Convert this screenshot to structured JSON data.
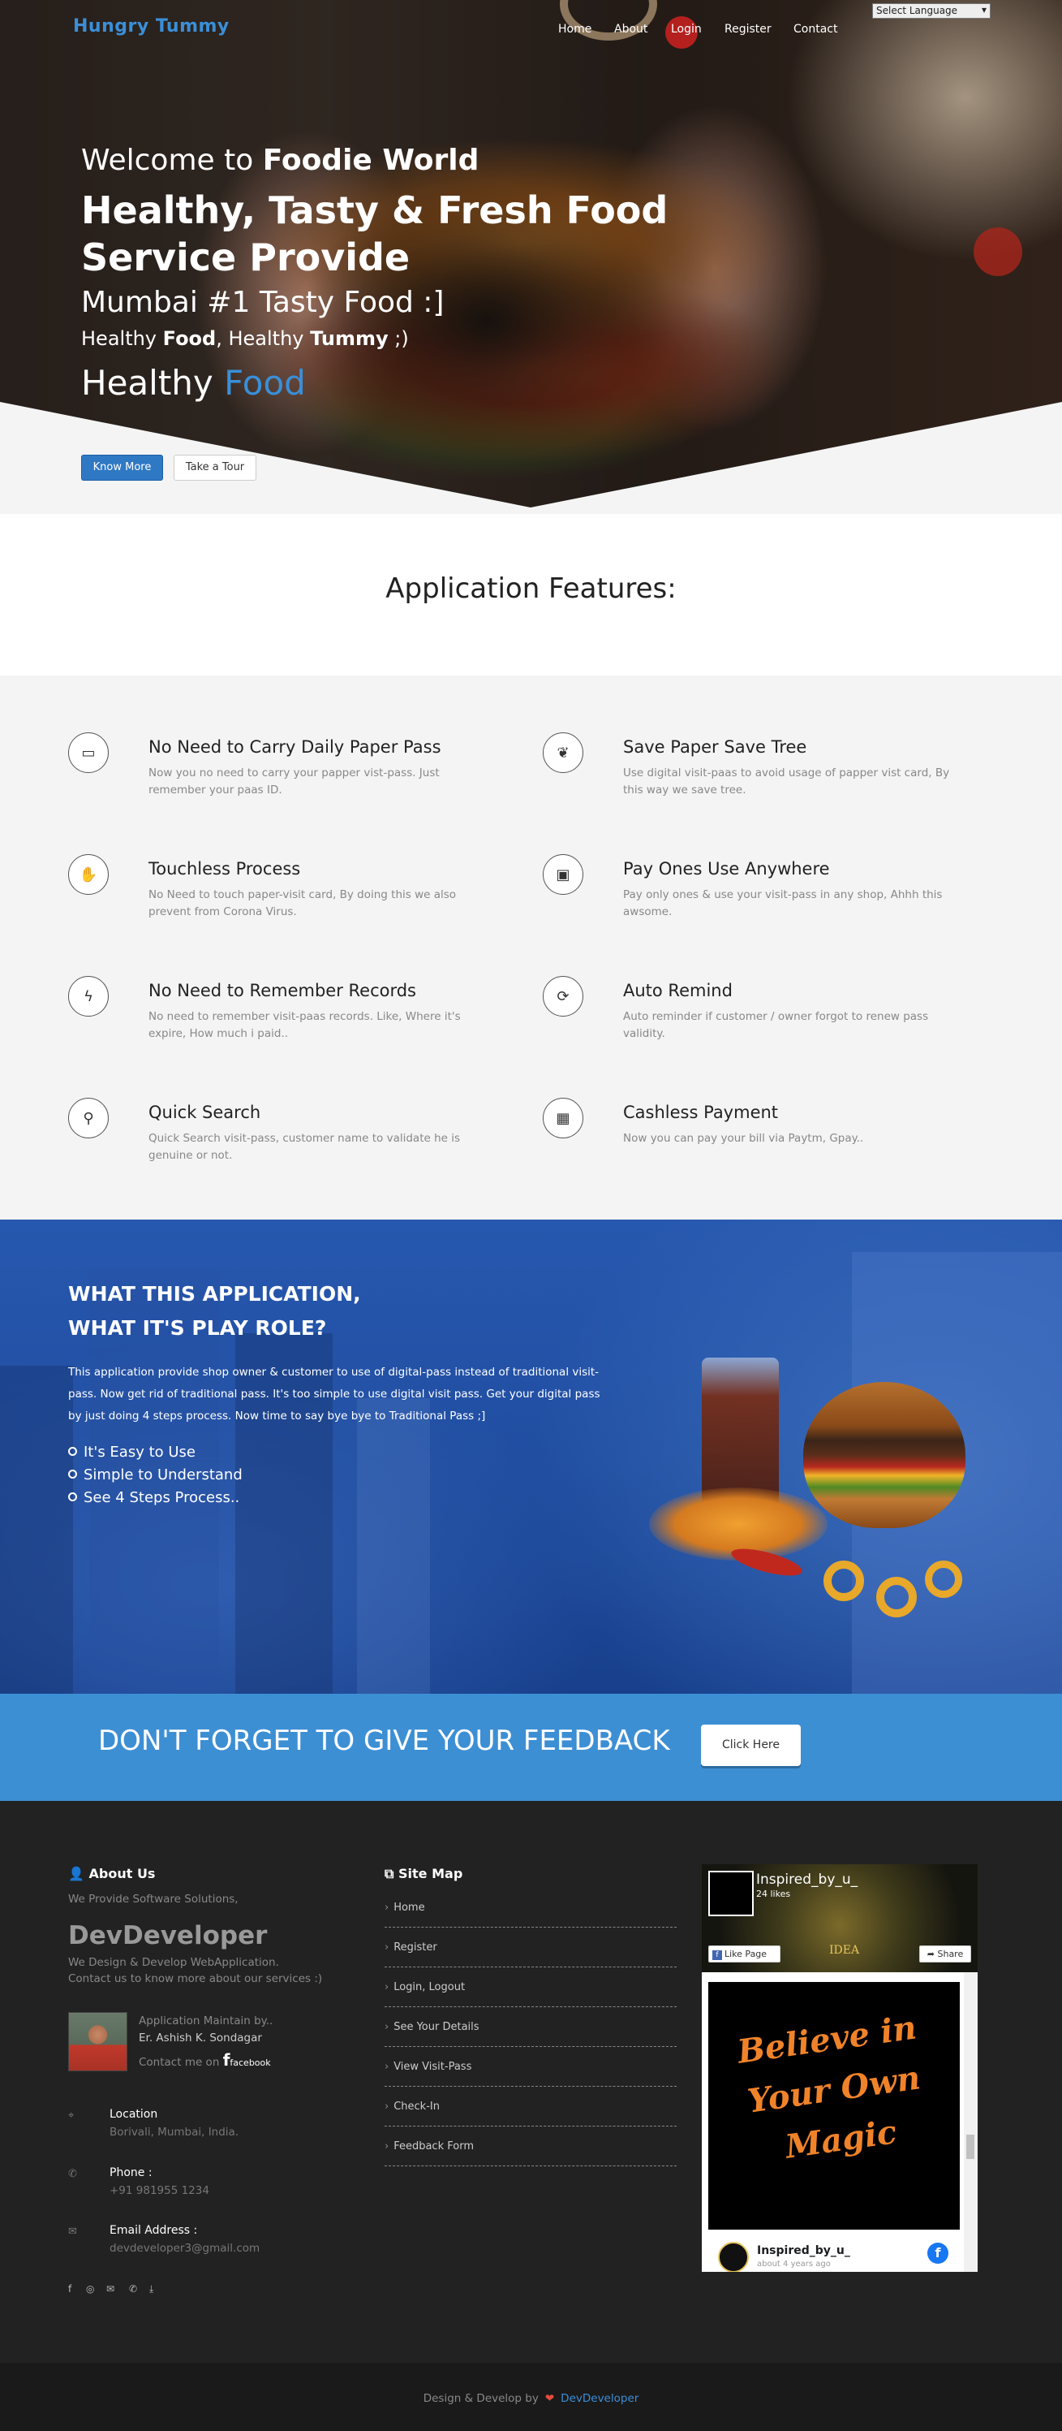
{
  "header": {
    "brand": "Hungry Tummy",
    "nav": [
      "Home",
      "About",
      "Login",
      "Register",
      "Contact"
    ],
    "language_select": "Select Language"
  },
  "hero": {
    "welcome_prefix": "Welcome to ",
    "welcome_name": "Foodie World",
    "headline_1": "Healthy, Tasty & Fresh Food",
    "headline_2": "Service Provide",
    "subline": "Mumbai #1 Tasty Food :]",
    "tag_1": "Healthy ",
    "tag_2": "Food",
    "tag_3": ", Healthy ",
    "tag_4": "Tummy",
    "tag_5": " ;)",
    "typed_1": "Healthy ",
    "typed_2": "Food",
    "know_more": "Know More",
    "take_tour": "Take a Tour"
  },
  "features": {
    "title": "Application Features:",
    "items": [
      {
        "icon": "id-card-icon",
        "title": "No Need to Carry Daily Paper Pass",
        "desc": "Now you no need to carry your papper vist-pass. Just remember your paas ID."
      },
      {
        "icon": "leaf-icon",
        "title": "Save Paper Save Tree",
        "desc": "Use digital visit-paas to avoid usage of papper vist card, By this way we save tree."
      },
      {
        "icon": "hand-icon",
        "title": "Touchless Process",
        "desc": "No Need to touch paper-visit card, By doing this we also prevent from Corona Virus."
      },
      {
        "icon": "money-icon",
        "title": "Pay Ones Use Anywhere",
        "desc": "Pay only ones & use your visit-pass in any shop, Ahhh this awsome."
      },
      {
        "icon": "bolt-icon",
        "title": "No Need to Remember Records",
        "desc": "No need to remember visit-paas records. Like, Where it's expire, How much i paid.."
      },
      {
        "icon": "refresh-icon",
        "title": "Auto Remind",
        "desc": "Auto reminder if customer / owner forgot to renew pass validity."
      },
      {
        "icon": "search-icon",
        "title": "Quick Search",
        "desc": "Quick Search visit-pass, customer name to validate he is genuine or not."
      },
      {
        "icon": "qrcode-icon",
        "title": "Cashless Payment",
        "desc": "Now you can pay your bill via Paytm, Gpay.."
      }
    ]
  },
  "about_app": {
    "heading_1": "WHAT THIS APPLICATION,",
    "heading_2": "WHAT IT'S PLAY ROLE?",
    "paragraph": "This application provide shop owner & customer to use of digital-pass instead of traditional visit-pass. Now get rid of traditional pass. It's too simple to use digital visit pass. Get your digital pass by just doing 4 steps process. Now time to say bye bye to Traditional Pass ;]",
    "points": [
      "It's Easy to Use",
      "Simple to Understand",
      "See 4 Steps Process.."
    ]
  },
  "feedback": {
    "text": "DON'T FORGET TO GIVE YOUR FEEDBACK",
    "button": "Click Here"
  },
  "footer": {
    "about": {
      "heading": "About Us",
      "intro": "We Provide Software Solutions,",
      "brand": "DevDeveloper",
      "line_1": "We Design & Develop WebApplication.",
      "line_2": "Contact us to know more about our services :)",
      "maintain_label": "Application Maintain by..",
      "maintainer": "Er. Ashish K. Sondagar",
      "contact_me": "Contact me on",
      "facebook": "facebook"
    },
    "contact": {
      "location_label": "Location",
      "location_value": "Borivali, Mumbai, India.",
      "phone_label": "Phone :",
      "phone_value": "+91 981955 1234",
      "email_label": "Email Address :",
      "email_value": "devdeveloper3@gmail.com"
    },
    "sitemap": {
      "heading": "Site Map",
      "items": [
        "Home",
        "Register",
        "Login, Logout",
        "See Your Details",
        "View Visit-Pass",
        "Check-In",
        "Feedback Form"
      ]
    },
    "fb_widget": {
      "page_name": "Inspired_by_u_",
      "likes": "24 likes",
      "like_page": "Like Page",
      "share": "Share",
      "idea": "IDEA",
      "post_text_1": "Believe in",
      "post_text_2": "Your Own",
      "post_text_3": "Magic",
      "post_author": "Inspired_by_u_",
      "post_time": "about 4 years ago"
    },
    "copyright_prefix": "Design & Develop by",
    "copyright_brand": "DevDeveloper"
  }
}
